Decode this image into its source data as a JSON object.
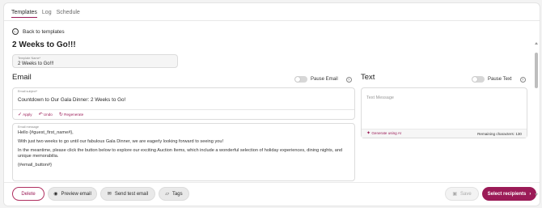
{
  "tabs": [
    {
      "label": "Templates",
      "active": true
    },
    {
      "label": "Log",
      "active": false
    },
    {
      "label": "Schedule",
      "active": false
    }
  ],
  "back_link": "Back to templates",
  "page_title": "2 Weeks to Go!!!",
  "template_name": {
    "label": "Template Name*",
    "value": "2 Weeks to Go!!!"
  },
  "email": {
    "title": "Email",
    "pause_label": "Pause Email",
    "pause_on": false,
    "subject": {
      "label": "Email subject*",
      "value": "Countdown to Our Gala Dinner: 2 Weeks to Go!"
    },
    "actions": {
      "apply": "Apply",
      "undo": "Undo",
      "regenerate": "Regenerate"
    },
    "message": {
      "label": "Email message",
      "paragraphs": [
        "Hello {#guest_first_name#},",
        "With just two weeks to go until our fabulous Gala Dinner, we are eagerly looking forward to seeing you!",
        "In the meantime, please click the button below to explore our exciting Auction Items, which include a wonderful selection of holiday experiences, dining nights, and unique memorabilia.",
        "{#email_button#}"
      ]
    }
  },
  "text": {
    "title": "Text",
    "pause_label": "Pause Text",
    "pause_on": false,
    "placeholder": "Text Message",
    "generate_ai": "Generate using AI",
    "remaining": "Remaining characters: 130"
  },
  "footer": {
    "delete": "Delete",
    "preview": "Preview email",
    "send_test": "Send test email",
    "tags": "Tags",
    "save": "Save",
    "select_recipients": "Select recipients"
  },
  "colors": {
    "accent": "#9b1b57"
  }
}
